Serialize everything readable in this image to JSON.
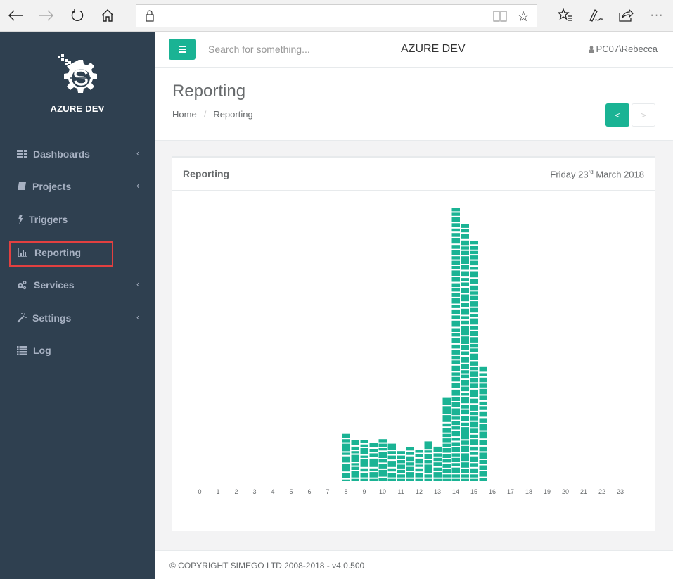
{
  "browser": {
    "back_icon": "arrow-left-icon",
    "forward_icon": "arrow-right-icon",
    "refresh_icon": "refresh-icon",
    "home_icon": "home-icon",
    "address_value": "",
    "lock_icon": "lock-icon",
    "reading_view_icon": "book-icon",
    "favorite_icon": "star-icon",
    "favorites_hub_icon": "star-list-icon",
    "notes_icon": "pen-icon",
    "share_icon": "share-icon",
    "more_icon": "ellipsis-icon",
    "more_label": "···"
  },
  "sidebar": {
    "brand": "AZURE DEV",
    "items": [
      {
        "label": "Dashboards",
        "icon": "grid-icon",
        "has_children": true
      },
      {
        "label": "Projects",
        "icon": "book-icon",
        "has_children": true
      },
      {
        "label": "Triggers",
        "icon": "bolt-icon",
        "has_children": false
      },
      {
        "label": "Reporting",
        "icon": "bar-chart-icon",
        "has_children": false,
        "active": true
      },
      {
        "label": "Services",
        "icon": "cogs-icon",
        "has_children": true
      },
      {
        "label": "Settings",
        "icon": "magic-wand-icon",
        "has_children": true
      },
      {
        "label": "Log",
        "icon": "list-icon",
        "has_children": false
      }
    ],
    "chevron": "‹"
  },
  "topbar": {
    "search_placeholder": "Search for something...",
    "title": "AZURE DEV",
    "user": "PC07\\Rebecca"
  },
  "heading": {
    "title": "Reporting",
    "breadcrumb": [
      "Home",
      "Reporting"
    ],
    "prev_label": "<",
    "next_label": ">"
  },
  "card": {
    "title": "Reporting",
    "date_prefix": "Friday 23",
    "date_suffix": "rd",
    "date_rest": " March 2018"
  },
  "footer": {
    "text": "© COPYRIGHT SIMEGO LTD 2008-2018 - v4.0.500"
  },
  "colors": {
    "accent": "#1ab394",
    "sidebar_bg": "#2f4050",
    "highlight_border": "#e34040"
  },
  "chart_data": {
    "type": "bar",
    "stacked": true,
    "title": "",
    "xlabel": "",
    "ylabel": "",
    "x_ticks": [
      "0",
      "1",
      "2",
      "3",
      "4",
      "5",
      "6",
      "7",
      "8",
      "9",
      "10",
      "11",
      "12",
      "13",
      "14",
      "15",
      "16",
      "17",
      "18",
      "19",
      "20",
      "21",
      "22",
      "23"
    ],
    "xlim": [
      0,
      24
    ],
    "bin_hours": 0.5,
    "grid": false,
    "legend": "none",
    "bars": [
      {
        "start": 8.0,
        "segments": [
          4,
          9,
          12,
          10,
          5,
          12,
          6,
          7
        ]
      },
      {
        "start": 8.5,
        "segments": [
          5,
          10,
          6,
          5,
          11,
          5,
          6,
          9
        ]
      },
      {
        "start": 9.0,
        "segments": [
          5,
          8,
          6,
          12,
          5,
          10,
          5,
          6
        ]
      },
      {
        "start": 9.5,
        "segments": [
          5,
          9,
          5,
          13,
          7,
          6,
          8
        ]
      },
      {
        "start": 10.0,
        "segments": [
          6,
          11,
          8,
          6,
          10,
          5,
          6,
          6
        ]
      },
      {
        "start": 10.5,
        "segments": [
          5,
          8,
          6,
          10,
          7,
          6,
          10
        ]
      },
      {
        "start": 11.0,
        "segments": [
          5,
          6,
          6,
          7,
          6,
          6,
          6
        ]
      },
      {
        "start": 11.5,
        "segments": [
          5,
          9,
          7,
          6,
          8,
          6,
          6
        ]
      },
      {
        "start": 12.0,
        "segments": [
          5,
          8,
          6,
          5,
          8,
          6,
          6
        ]
      },
      {
        "start": 12.5,
        "segments": [
          5,
          6,
          13,
          6,
          8,
          5,
          12
        ]
      },
      {
        "start": 13.0,
        "segments": [
          5,
          9,
          6,
          7,
          6,
          6,
          9
        ]
      },
      {
        "start": 13.5,
        "segments": [
          5,
          6,
          7,
          7,
          6,
          7,
          8,
          6,
          7,
          6,
          8,
          6,
          11,
          12,
          11
        ]
      },
      {
        "start": 14.0,
        "segments": [
          5,
          6,
          9,
          6,
          7,
          6,
          8,
          7,
          6,
          9,
          6,
          7,
          6,
          11,
          8,
          7,
          10,
          9,
          8,
          6,
          9,
          7,
          6,
          8,
          7,
          9,
          6,
          7,
          10,
          7,
          8,
          6,
          9,
          7,
          6,
          7,
          8,
          9,
          6,
          7,
          6,
          8,
          7,
          9,
          7,
          6,
          7,
          8,
          6,
          6
        ]
      },
      {
        "start": 14.5,
        "segments": [
          5,
          6,
          7,
          9,
          12,
          10,
          7,
          18,
          6,
          9,
          8,
          7,
          10,
          6,
          8,
          9,
          7,
          6,
          8,
          10,
          7,
          8,
          12,
          14,
          7,
          6,
          10,
          8,
          11,
          9,
          7,
          6,
          9,
          8,
          12,
          7,
          6,
          8,
          9,
          6,
          7
        ]
      },
      {
        "start": 15.0,
        "segments": [
          5,
          6,
          8,
          7,
          9,
          6,
          7,
          10,
          6,
          8,
          9,
          7,
          6,
          10,
          8,
          12,
          8,
          7,
          9,
          6,
          8,
          10,
          7,
          6,
          9,
          8,
          7,
          10,
          6,
          8,
          9,
          7,
          6,
          8,
          9,
          10,
          6,
          8,
          7,
          6,
          7,
          6
        ]
      },
      {
        "start": 15.5,
        "segments": [
          6,
          9,
          8,
          7,
          10,
          8,
          9,
          11,
          10,
          8,
          9,
          7,
          6,
          8,
          9,
          7,
          8,
          6,
          9
        ]
      }
    ]
  }
}
